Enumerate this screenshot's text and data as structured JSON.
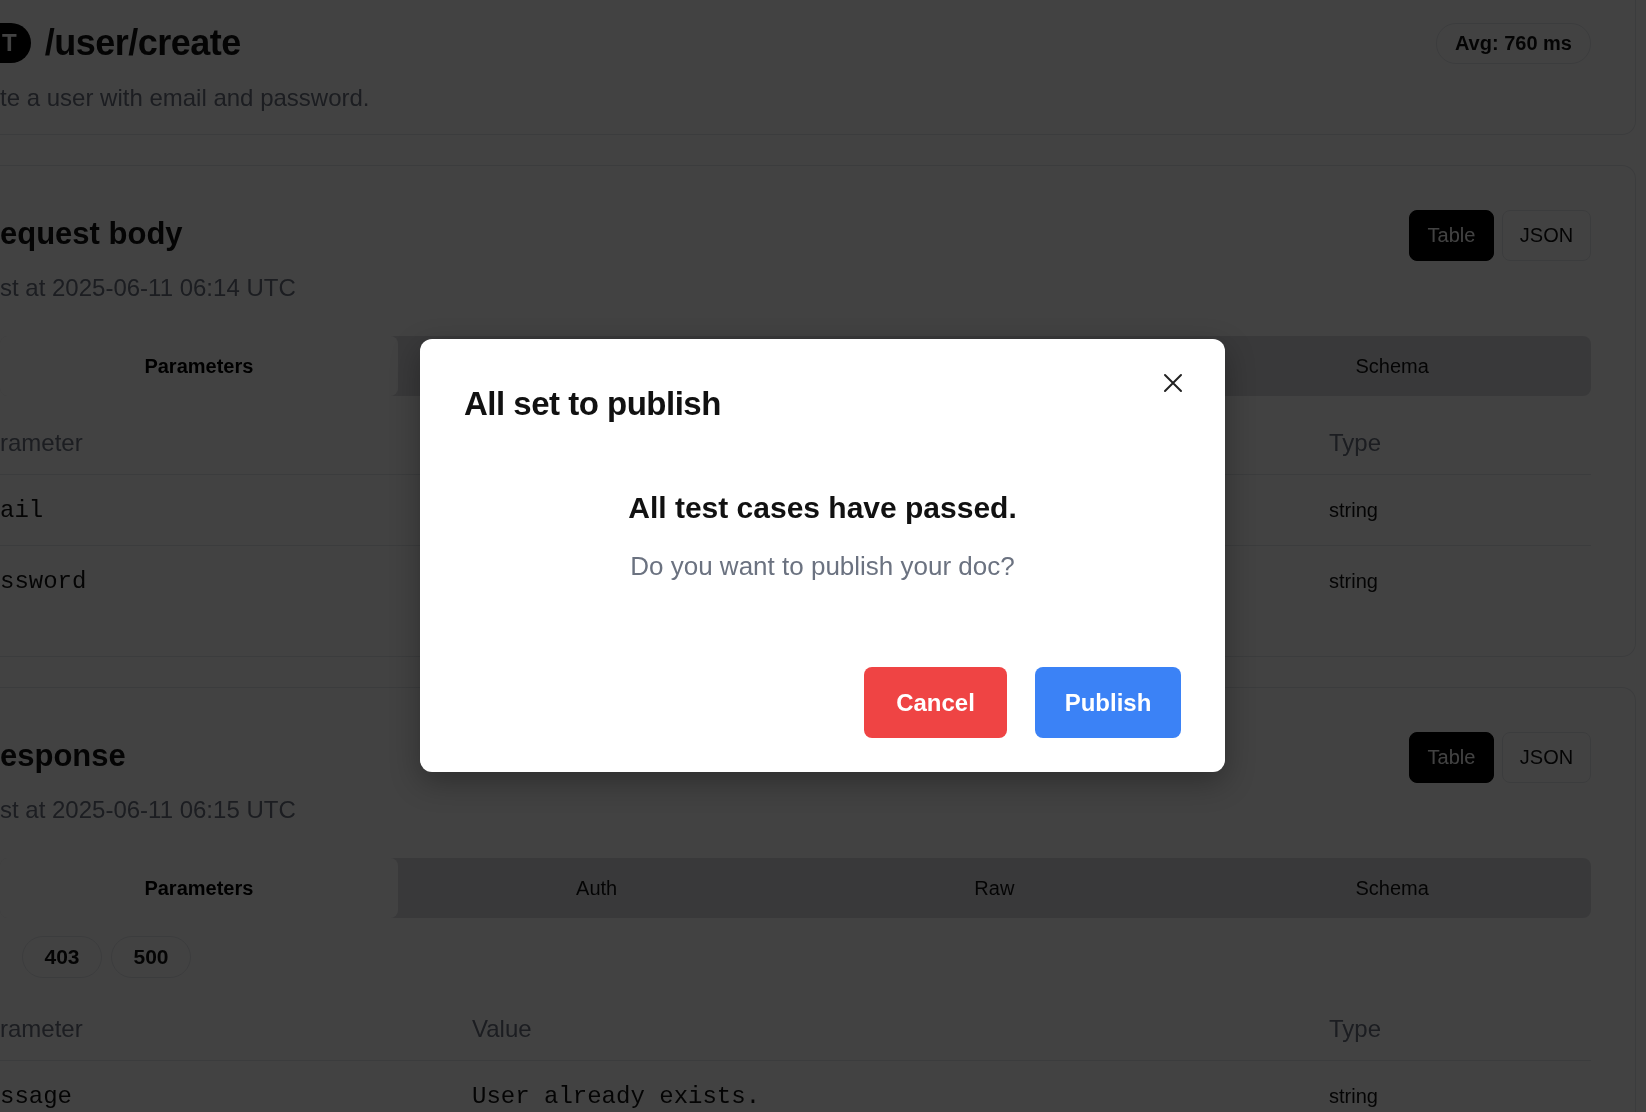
{
  "endpoint": {
    "method_badge": "T",
    "path": "/user/create",
    "description": "te a user with email and password.",
    "avg": "Avg: 760 ms"
  },
  "sections": [
    {
      "title": "equest body",
      "timestamp": "st at 2025-06-11 06:14 UTC",
      "view_toggle": [
        {
          "label": "Table",
          "selected": true
        },
        {
          "label": "JSON",
          "selected": false
        }
      ],
      "tabs": [
        {
          "label": "Parameters",
          "selected": true
        },
        {
          "label": "Schema",
          "selected": false
        }
      ],
      "columns": [
        {
          "kind": "parameter",
          "label": "rameter"
        },
        {
          "kind": "type",
          "label": "Type"
        }
      ],
      "rows": [
        {
          "parameter": "ail",
          "type": "string"
        },
        {
          "parameter": "ssword",
          "type": "string"
        }
      ]
    },
    {
      "title": "esponse",
      "timestamp": "st at 2025-06-11 06:15 UTC",
      "view_toggle": [
        {
          "label": "Table",
          "selected": true
        },
        {
          "label": "JSON",
          "selected": false
        }
      ],
      "tabs": [
        {
          "label": "Parameters",
          "selected": true
        },
        {
          "label": "Auth",
          "selected": false
        },
        {
          "label": "Raw",
          "selected": false
        },
        {
          "label": "Schema",
          "selected": false
        }
      ],
      "status_codes": [
        "403",
        "500"
      ],
      "columns": [
        {
          "kind": "parameter",
          "label": "rameter"
        },
        {
          "kind": "value",
          "label": "Value"
        },
        {
          "kind": "type",
          "label": "Type"
        }
      ],
      "rows": [
        {
          "parameter": "ssage",
          "value": "User already exists.",
          "type": "string"
        }
      ]
    }
  ],
  "dialog": {
    "title": "All set to publish",
    "heading": "All test cases have passed.",
    "message": "Do you want to publish your doc?",
    "buttons": [
      {
        "label": "Cancel",
        "kind": "danger"
      },
      {
        "label": "Publish",
        "kind": "primary"
      }
    ]
  }
}
